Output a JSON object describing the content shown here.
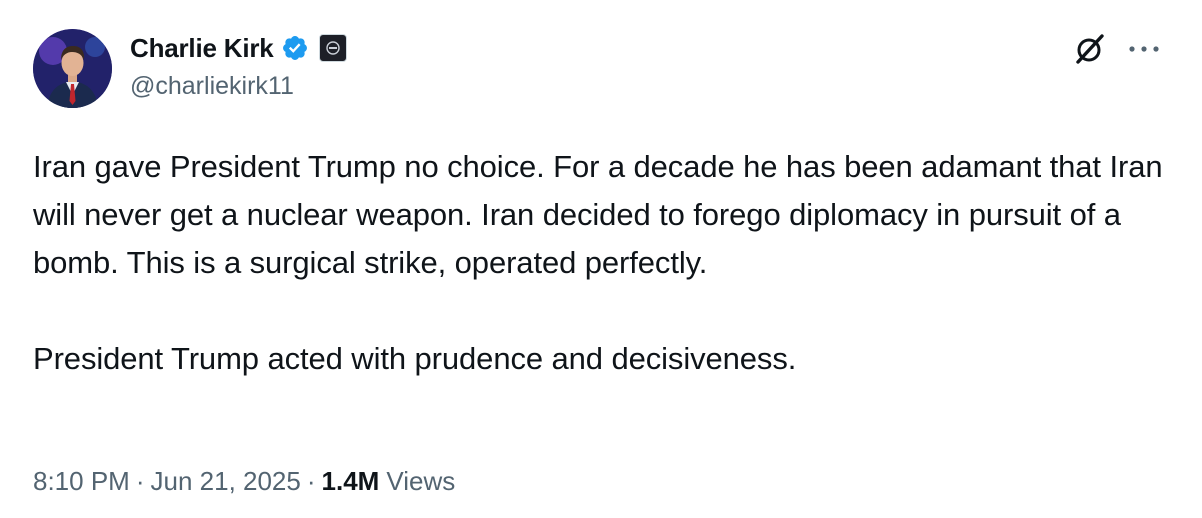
{
  "author": {
    "display_name": "Charlie Kirk",
    "handle": "@charliekirk11",
    "verified_badge_color": "#1d9bf0",
    "affiliate_badge": "organization-logo"
  },
  "header_actions": {
    "grok_icon": "grok-icon",
    "more_icon": "more-options-icon"
  },
  "tweet": {
    "text": "Iran gave President Trump no choice. For a decade he has been adamant that Iran will never get a nuclear weapon. Iran decided to forego diplomacy in pursuit of a bomb. This is a surgical strike, operated perfectly.\n\nPresident Trump acted with prudence and decisiveness."
  },
  "meta": {
    "time": "8:10 PM",
    "separator": "·",
    "date": "Jun 21, 2025",
    "views_count": "1.4M",
    "views_label": "Views"
  },
  "colors": {
    "text_primary": "#0f1419",
    "text_secondary": "#536471",
    "background": "#ffffff"
  }
}
